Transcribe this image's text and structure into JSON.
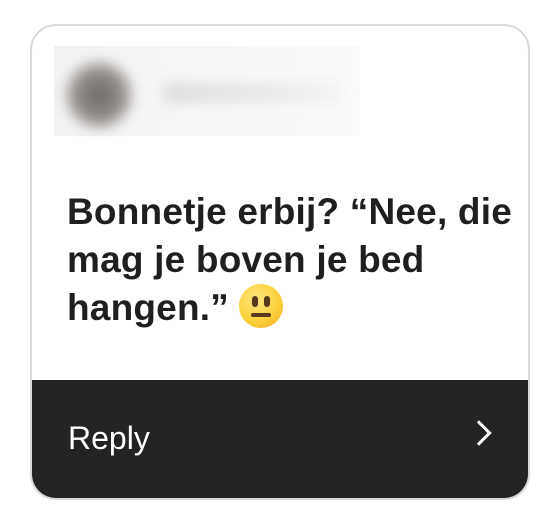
{
  "message": {
    "text": "Bonnetje erbij? “Nee, die mag je boven je bed hangen.”",
    "emoji": "neutral-face-icon"
  },
  "footer": {
    "reply_label": "Reply",
    "chevron": "chevron-right-icon"
  },
  "colors": {
    "footer_bg": "#232323",
    "text": "#1f1f1f",
    "emoji_yellow": "#fcd13c"
  }
}
